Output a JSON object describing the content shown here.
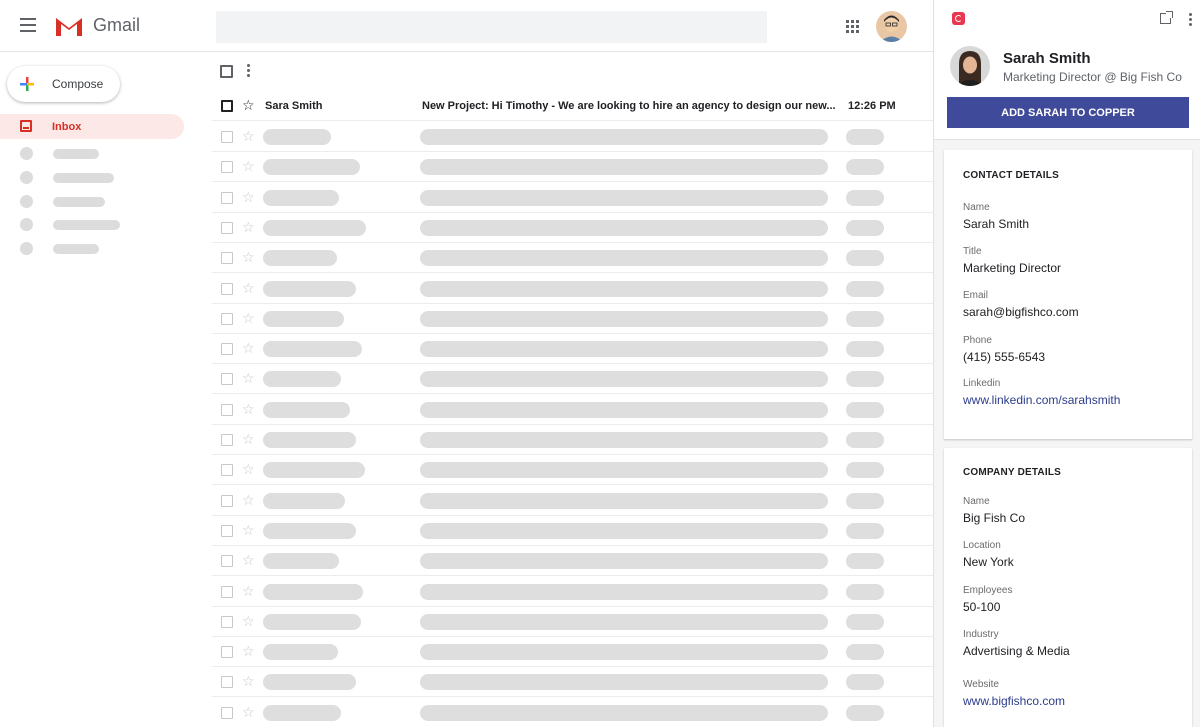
{
  "gmail": {
    "brand": "Gmail",
    "compose_label": "Compose",
    "inbox_label": "Inbox",
    "email": {
      "sender": "Sara Smith",
      "subject": "New Project: Hi Timothy - We are looking to hire an agency to design our new...",
      "time": "12:26 PM"
    }
  },
  "copper": {
    "contact_name": "Sarah Smith",
    "contact_role": "Marketing Director @ Big Fish Co",
    "add_button": "ADD SARAH TO COPPER",
    "contact_details": {
      "title": "CONTACT DETAILS",
      "fields": [
        {
          "label": "Name",
          "value": "Sarah Smith"
        },
        {
          "label": "Title",
          "value": "Marketing Director"
        },
        {
          "label": "Email",
          "value": "sarah@bigfishco.com"
        },
        {
          "label": "Phone",
          "value": "(415) 555-6543"
        },
        {
          "label": "Linkedin",
          "value": "www.linkedin.com/sarahsmith"
        }
      ]
    },
    "company_details": {
      "title": "COMPANY DETAILS",
      "fields": [
        {
          "label": "Name",
          "value": "Big Fish Co"
        },
        {
          "label": "Location",
          "value": "New York"
        },
        {
          "label": "Employees",
          "value": "50-100"
        },
        {
          "label": "Industry",
          "value": "Advertising & Media"
        },
        {
          "label": "Website",
          "value": "www.bigfishco.com"
        }
      ]
    }
  },
  "colors": {
    "gmail_red": "#d93025",
    "copper_button": "#3f4a9a",
    "copper_brand": "#e8374f",
    "link": "#2d3c8c"
  },
  "icons": [
    "menu-icon",
    "gmail-logo",
    "apps-grid-icon",
    "plus-icon",
    "inbox-icon",
    "more-vert-icon",
    "star-icon",
    "copper-logo",
    "open-in-new-icon"
  ]
}
